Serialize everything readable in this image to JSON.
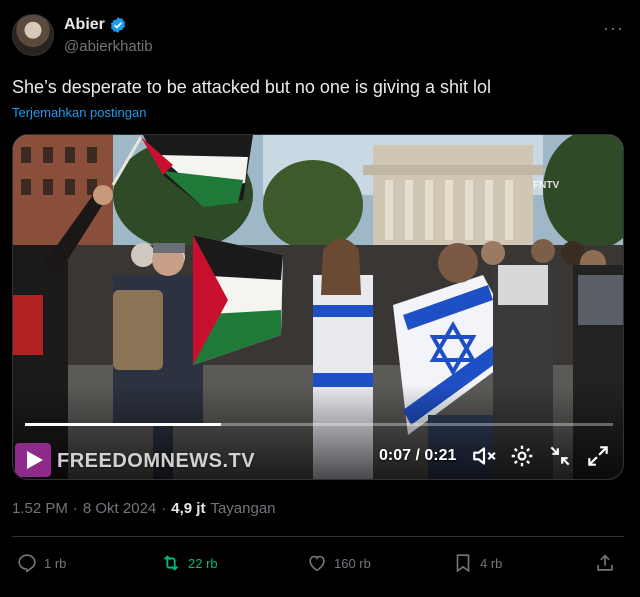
{
  "author": {
    "display_name": "Abier",
    "handle": "@abierkhatib",
    "verified": true
  },
  "more_icon": "more-options-icon",
  "tweet": {
    "text": "She’s desperate to be attacked but no one is giving a shit lol",
    "translate_label": "Terjemahkan postingan"
  },
  "video": {
    "watermark": "FREEDOMNEWS.TV",
    "corner_logo": "FNTV",
    "time": "0:07 / 0:21",
    "progress": 0.333
  },
  "meta": {
    "time": "1.52 PM",
    "dot1": "·",
    "date": "8 Okt 2024",
    "dot2": "·",
    "views_count": "4,9 jt",
    "views_label": "Tayangan"
  },
  "actions": {
    "reply_count": "1 rb",
    "retweet_count": "22 rb",
    "like_count": "160 rb",
    "bookmark_count": "4 rb"
  },
  "colors": {
    "accent": "#1d9bf0",
    "retweet": "#00ba7c",
    "muted": "#71767b",
    "text": "#e7e9ea",
    "background": "#000000"
  }
}
